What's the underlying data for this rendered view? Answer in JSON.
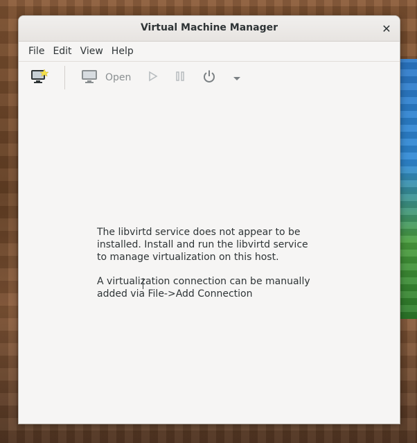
{
  "window": {
    "title": "Virtual Machine Manager"
  },
  "menubar": {
    "items": [
      "File",
      "Edit",
      "View",
      "Help"
    ]
  },
  "toolbar": {
    "open_label": "Open"
  },
  "content": {
    "message_paragraph_1": "The libvirtd service does not appear to be\ninstalled. Install and run the libvirtd service\nto manage virtualization on this host.",
    "message_paragraph_2": "A virtualization connection can be manually\nadded via File->Add Connection"
  },
  "colors": {
    "window_bg": "#f6f5f4",
    "text": "#2e3436",
    "disabled_text": "#8a8f91"
  },
  "icons": {
    "new_vm": "new-vm-icon",
    "open": "monitor-icon",
    "play": "play-icon",
    "pause": "pause-icon",
    "power": "power-icon",
    "dropdown": "chevron-down-icon",
    "close": "close-icon"
  }
}
